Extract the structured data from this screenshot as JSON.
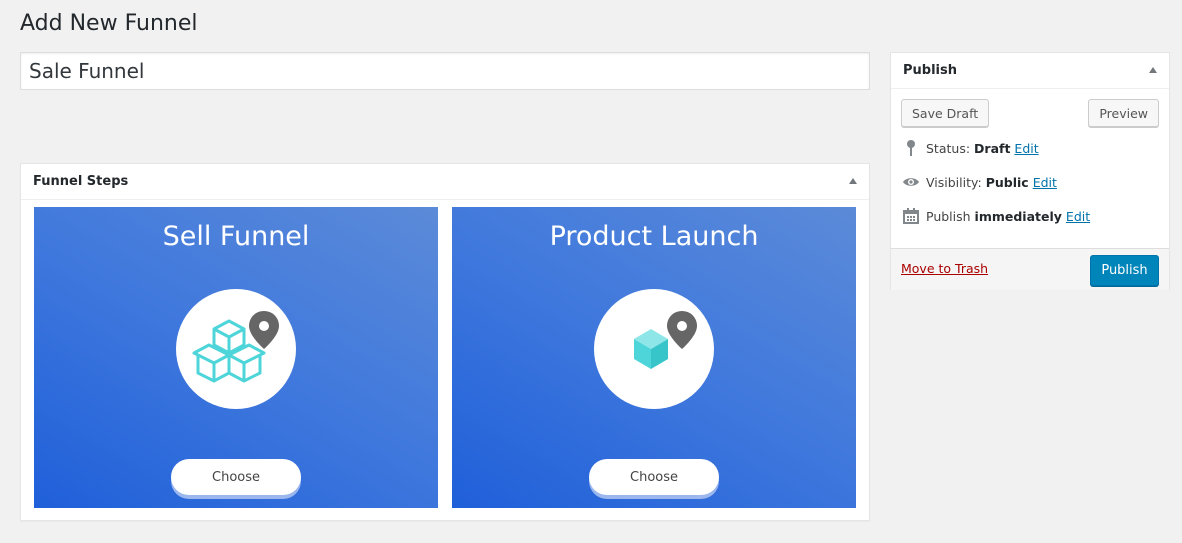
{
  "page": {
    "title": "Add New Funnel"
  },
  "title_field": {
    "value": "Sale Funnel"
  },
  "funnel_steps": {
    "heading": "Funnel Steps",
    "cards": [
      {
        "title": "Sell Funnel",
        "icon": "open-boxes-with-pin-icon",
        "button_label": "Choose"
      },
      {
        "title": "Product Launch",
        "icon": "cube-with-pin-icon",
        "button_label": "Choose"
      }
    ]
  },
  "publish": {
    "heading": "Publish",
    "save_draft_label": "Save Draft",
    "preview_label": "Preview",
    "status_label": "Status:",
    "status_value": "Draft",
    "visibility_label": "Visibility:",
    "visibility_value": "Public",
    "schedule_label": "Publish",
    "schedule_value": "immediately",
    "edit_label": "Edit",
    "trash_label": "Move to Trash",
    "publish_label": "Publish"
  },
  "colors": {
    "card_gradient_start": "#1f5fd9",
    "card_gradient_end": "#5b8ad8",
    "icon_teal": "#4dd5d9",
    "pin_gray": "#666666",
    "primary_button": "#0085ba",
    "link": "#0073aa",
    "trash": "#aa0000"
  }
}
